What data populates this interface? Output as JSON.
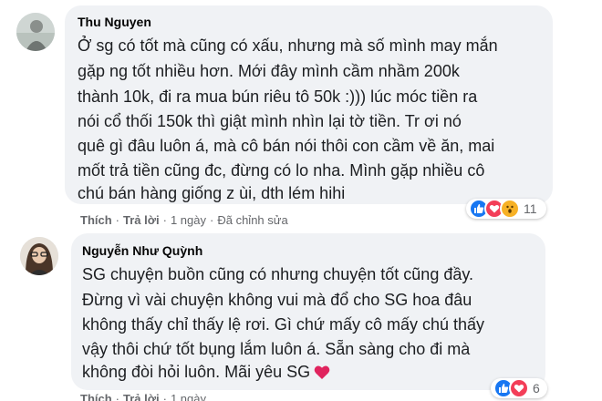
{
  "comments": [
    {
      "author": "Thu Nguyen",
      "lines": [
        "Ở sg có tốt mà cũng có xấu, nhưng mà số mình may mắn",
        "gặp ng tốt nhiều hơn. Mới đây mình cầm nhầm 200k",
        "thành 10k, đi ra mua bún riêu tô 50k :))) lúc móc tiền ra",
        "nói cổ thối 150k thì giật mình nhìn lại tờ tiền. Tr ơi nó",
        "quê gì đâu luôn á, mà cô bán nói thôi con cầm về ăn, mai",
        "mốt trả tiền cũng đc, đừng có lo nha. Mình gặp nhiều cô",
        "chú bán hàng giống z ùi, dth lém hihi"
      ],
      "actions": {
        "like": "Thích",
        "reply": "Trả lời",
        "time": "1 ngày",
        "edited": "Đã chỉnh sửa"
      },
      "reactions": {
        "icons": [
          "like-icon",
          "love-icon",
          "wow-icon"
        ],
        "count": "11"
      }
    },
    {
      "author": "Nguyễn Như Quỳnh",
      "lines": [
        "SG chuyện buồn cũng có nhưng chuyện tốt cũng đầy.",
        "Đừng vì vài chuyện không vui mà đổ cho SG hoa đâu",
        "không thấy chỉ thấy lệ rơi. Gì chứ mấy cô mấy chú thấy",
        "vậy thôi chứ tốt bụng lắm luôn á. Sẵn sàng cho đi mà",
        "không đòi hỏi luôn. Mãi yêu SG"
      ],
      "trailing_emoji": "heart-icon",
      "actions": {
        "like": "Thích",
        "reply": "Trả lời",
        "time": "1 ngày"
      },
      "reactions": {
        "icons": [
          "like-icon",
          "love-icon"
        ],
        "count": "6"
      }
    }
  ],
  "colors": {
    "bubble": "#f0f2f5",
    "like_blue": "#1877f2",
    "love_red": "#f33e58",
    "wow_yellow": "#f7b125",
    "meta_gray": "#65676b"
  }
}
